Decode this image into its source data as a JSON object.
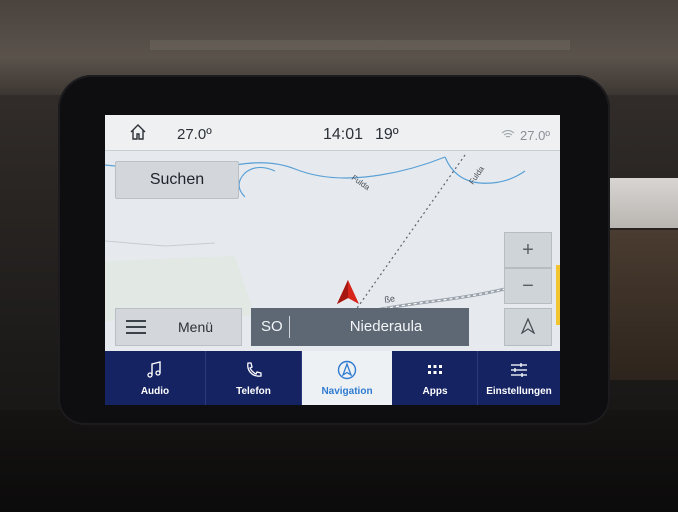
{
  "status": {
    "outside_temp": "27.0º",
    "time": "14:01",
    "temp_right": "19º",
    "climate_temp": "27.0º"
  },
  "map": {
    "search_label": "Suchen",
    "menu_label": "Menü",
    "zoom_in": "+",
    "zoom_out": "−",
    "road_labels": [
      "Fulda",
      "Fulda",
      "ße"
    ],
    "heading": "SO",
    "street": "Niederaula"
  },
  "tabs": [
    {
      "label": "Audio",
      "icon": "music-note-icon",
      "active": false
    },
    {
      "label": "Telefon",
      "icon": "phone-icon",
      "active": false
    },
    {
      "label": "Navigation",
      "icon": "navigation-icon",
      "active": true
    },
    {
      "label": "Apps",
      "icon": "apps-grid-icon",
      "active": false
    },
    {
      "label": "Einstellungen",
      "icon": "settings-sliders-icon",
      "active": false
    }
  ],
  "colors": {
    "tabbar": "#152363",
    "active_tab_text": "#2f7bd0",
    "position_arrow": "#d8251c",
    "map_background": "#e6eaee"
  }
}
